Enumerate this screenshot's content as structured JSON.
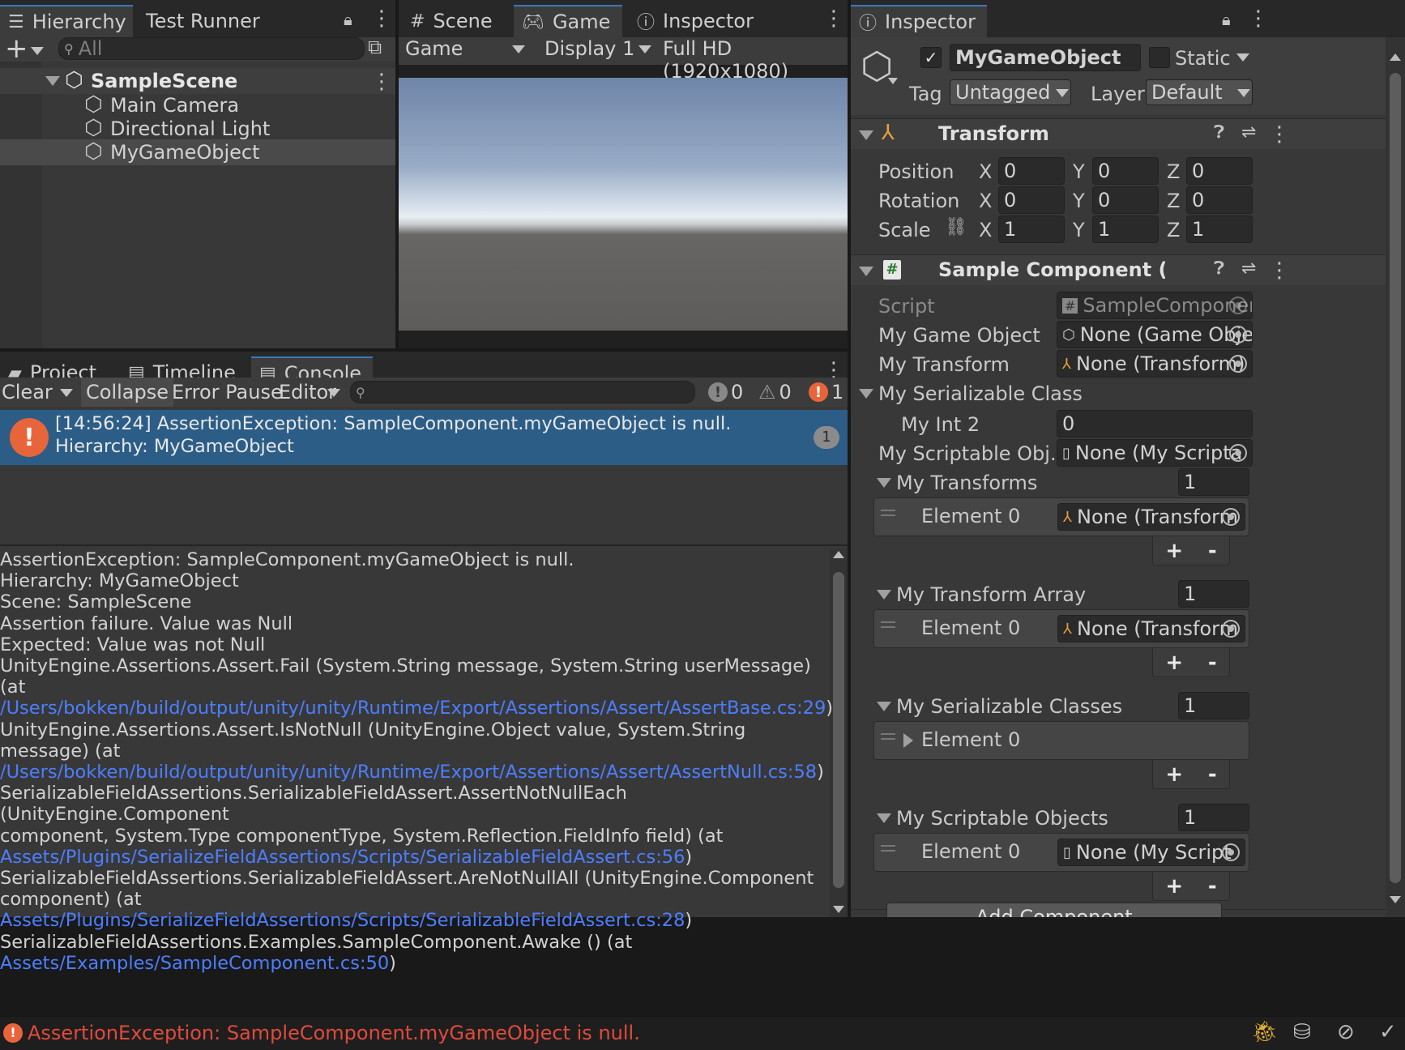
{
  "hierarchy": {
    "tabs": [
      "Hierarchy",
      "Test Runner"
    ],
    "search_placeholder": "All",
    "scene": "SampleScene",
    "items": [
      "Main Camera",
      "Directional Light",
      "MyGameObject"
    ]
  },
  "center_tabs": [
    "Scene",
    "Game",
    "Inspector"
  ],
  "game_toolbar": {
    "view": "Game",
    "display": "Display 1",
    "resolution": "Full HD (1920x1080)"
  },
  "bottom_tabs": [
    "Project",
    "Timeline",
    "Console"
  ],
  "console_toolbar": {
    "clear": "Clear",
    "collapse": "Collapse",
    "error_pause": "Error Pause",
    "editor": "Editor",
    "info_count": "0",
    "warn_count": "0",
    "error_count": "1"
  },
  "console_entry": {
    "line1": "[14:56:24] AssertionException: SampleComponent.myGameObject is null.",
    "line2": "Hierarchy: MyGameObject",
    "count": "1"
  },
  "console_detail": {
    "l1": "AssertionException: SampleComponent.myGameObject is null.",
    "l2": "Hierarchy: MyGameObject",
    "l3": "Scene: SampleScene",
    "l4": "Assertion failure. Value was Null",
    "l5": "Expected: Value was not Null",
    "l6": "UnityEngine.Assertions.Assert.Fail (System.String message, System.String userMessage) (at",
    "l7_link": "/Users/bokken/build/output/unity/unity/Runtime/Export/Assertions/Assert/AssertBase.cs:29",
    "l8": "UnityEngine.Assertions.Assert.IsNotNull (UnityEngine.Object value, System.String message) (at",
    "l9_link": "/Users/bokken/build/output/unity/unity/Runtime/Export/Assertions/Assert/AssertNull.cs:58",
    "l10": "SerializableFieldAssertions.SerializableFieldAssert.AssertNotNullEach (UnityEngine.Component",
    "l11": "component, System.Type componentType, System.Reflection.FieldInfo field) (at",
    "l12_link": "Assets/Plugins/SerializeFieldAssertions/Scripts/SerializableFieldAssert.cs:56",
    "l13": "SerializableFieldAssertions.SerializableFieldAssert.AreNotNullAll (UnityEngine.Component",
    "l14_pre": "component) (at ",
    "l14_link": "Assets/Plugins/SerializeFieldAssertions/Scripts/SerializableFieldAssert.cs:28",
    "l15": "SerializableFieldAssertions.Examples.SampleComponent.Awake () (at",
    "l16_link": "Assets/Examples/SampleComponent.cs:50",
    "close_paren": ")"
  },
  "status_bar": "AssertionException: SampleComponent.myGameObject is null.",
  "inspector": {
    "tab": "Inspector",
    "object_name": "MyGameObject",
    "static_label": "Static",
    "tag_label": "Tag",
    "tag_value": "Untagged",
    "layer_label": "Layer",
    "layer_value": "Default",
    "transform": {
      "title": "Transform",
      "position_label": "Position",
      "rotation_label": "Rotation",
      "scale_label": "Scale",
      "position": [
        "0",
        "0",
        "0"
      ],
      "rotation": [
        "0",
        "0",
        "0"
      ],
      "scale": [
        "1",
        "1",
        "1"
      ],
      "x": "X",
      "y": "Y",
      "z": "Z"
    },
    "component": {
      "title": "Sample Component (Script",
      "script_label": "Script",
      "script_value": "SampleComponen",
      "my_game_object_label": "My Game Object",
      "my_game_object_value": "None (Game Obje",
      "my_transform_label": "My Transform",
      "my_transform_value": "None (Transform)",
      "my_serializable_class_label": "My Serializable Class",
      "my_int2_label": "My Int 2",
      "my_int2_value": "0",
      "my_scriptable_label": "My Scriptable Obj...",
      "my_scriptable_value": "None (My Scripta",
      "my_transforms_label": "My Transforms",
      "my_transforms_size": "1",
      "element0": "Element 0",
      "transform_none": "None (Transform",
      "my_transform_array_label": "My Transform Array",
      "my_transform_array_size": "1",
      "my_serializable_classes_label": "My Serializable Classes",
      "my_serializable_classes_size": "1",
      "my_scriptable_objects_label": "My Scriptable Objects",
      "my_scriptable_objects_size": "1",
      "scriptable_none": "None (My Script"
    },
    "add_component": "Add Component"
  },
  "plus": "+",
  "minus": "-"
}
